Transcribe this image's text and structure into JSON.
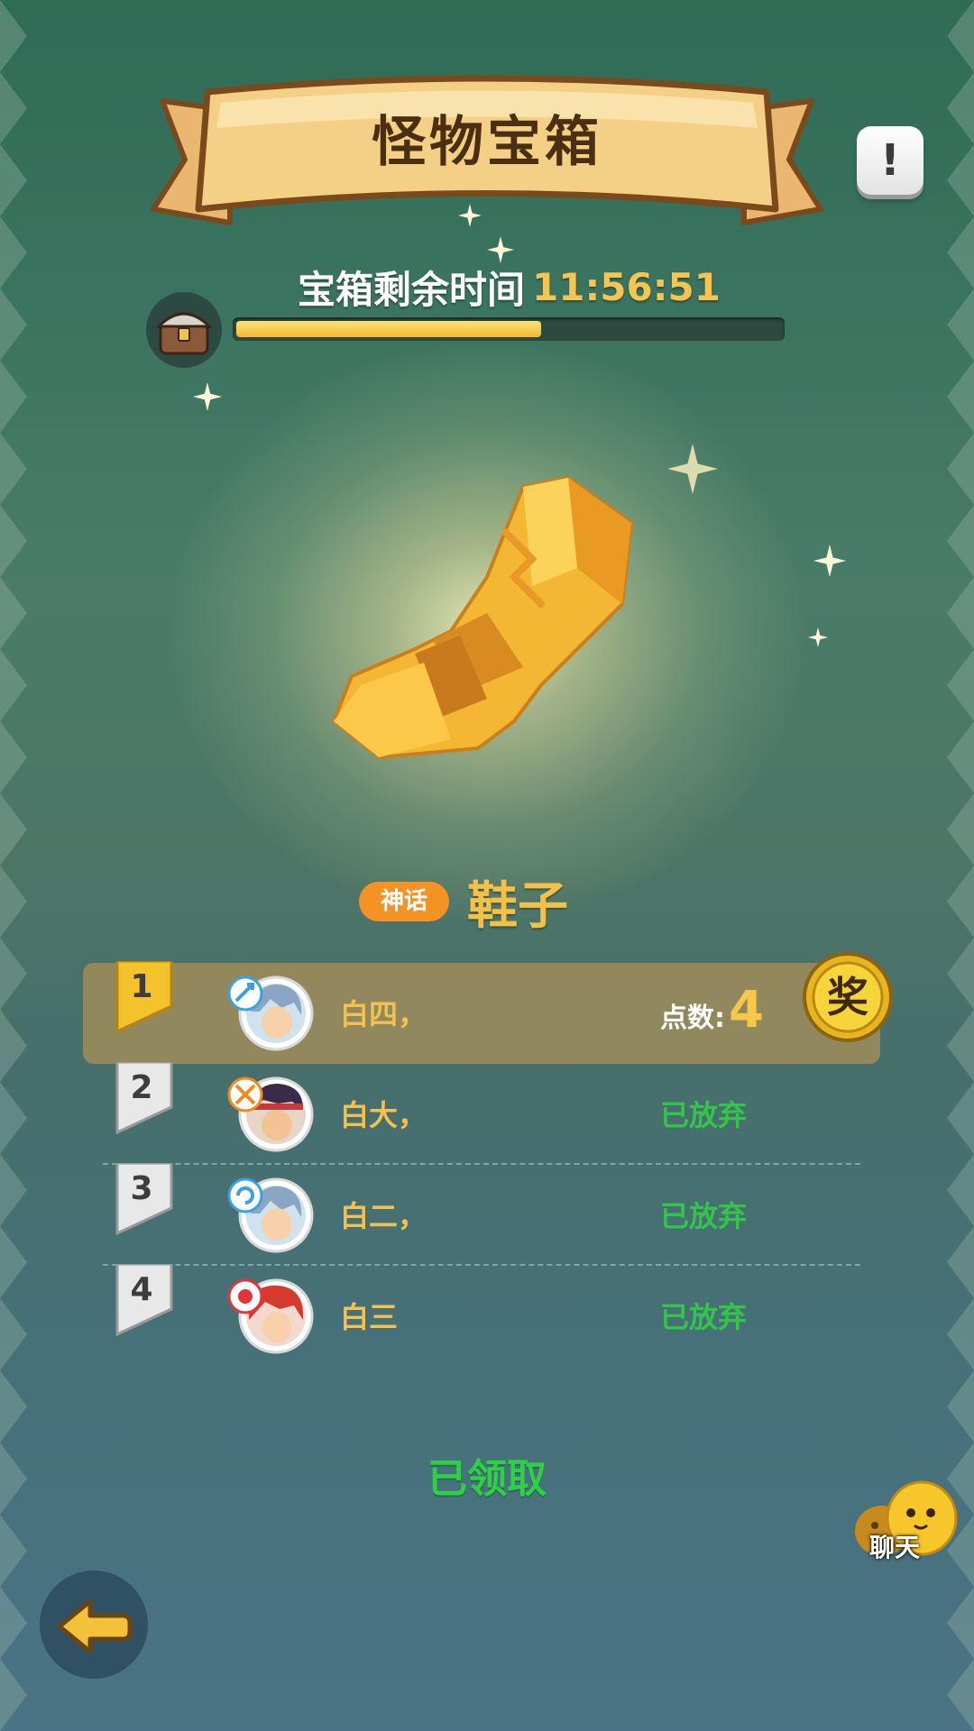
{
  "header": {
    "title": "怪物宝箱",
    "info_icon": "exclamation-icon",
    "info_label": "!"
  },
  "timer": {
    "label": "宝箱剩余时间",
    "value": "11:56:51",
    "progress": 0.56
  },
  "item": {
    "rarity": "神话",
    "name": "鞋子",
    "icon": "golden-boot-icon"
  },
  "ranking": [
    {
      "rank": "1",
      "name": "白四，",
      "status": "",
      "points_label": "点数:",
      "points_value": "4",
      "winner": true
    },
    {
      "rank": "2",
      "name": "白大，",
      "status": "已放弃"
    },
    {
      "rank": "3",
      "name": "白二，",
      "status": "已放弃"
    },
    {
      "rank": "4",
      "name": "白三",
      "status": "已放弃"
    }
  ],
  "award_badge": "奖",
  "claimed": "已领取",
  "chat": {
    "label": "聊天"
  },
  "colors": {
    "accent_gold": "#f6c451",
    "status_green": "#35c44a",
    "rarity_orange": "#f39323"
  }
}
